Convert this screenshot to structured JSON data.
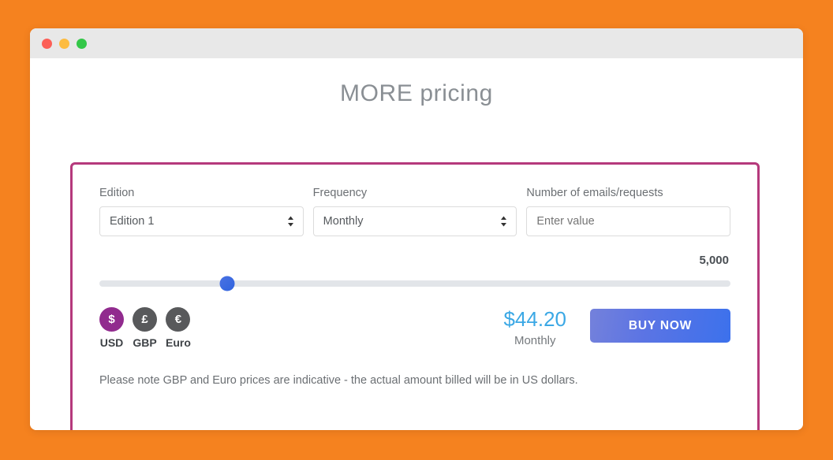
{
  "window": {
    "traffic_lights": [
      {
        "name": "close",
        "color": "#FC5F57"
      },
      {
        "name": "minimize",
        "color": "#FDBC40"
      },
      {
        "name": "maximize",
        "color": "#33C748"
      }
    ]
  },
  "page": {
    "title": "MORE pricing",
    "background_color": "#F5821F"
  },
  "panel": {
    "border_color": "#B5397C",
    "fields": {
      "edition": {
        "label": "Edition",
        "value": "Edition 1",
        "arrow_icon": "chevron-updown-icon"
      },
      "frequency": {
        "label": "Frequency",
        "value": "Monthly",
        "arrow_icon": "chevron-updown-icon"
      },
      "emails": {
        "label": "Number of emails/requests",
        "value": "",
        "placeholder": "Enter value"
      }
    },
    "slider": {
      "value_label": "5,000",
      "percent": 20,
      "thumb_color": "#3B6FE0",
      "track_color": "#E2E5E9"
    },
    "currencies": [
      {
        "label": "USD",
        "symbol": "$",
        "active": true,
        "color": "#912B8E"
      },
      {
        "label": "GBP",
        "symbol": "£",
        "active": false,
        "color": "#58595B"
      },
      {
        "label": "Euro",
        "symbol": "€",
        "active": false,
        "color": "#58595B"
      }
    ],
    "price": {
      "amount": "$44.20",
      "period": "Monthly",
      "color": "#3BA8E5"
    },
    "buy_button": {
      "label": "BUY NOW",
      "gradient_from": "#7481DB",
      "gradient_to": "#3C71EC"
    },
    "footnote": "Please note GBP and Euro prices are indicative - the actual amount billed will be in US dollars."
  }
}
